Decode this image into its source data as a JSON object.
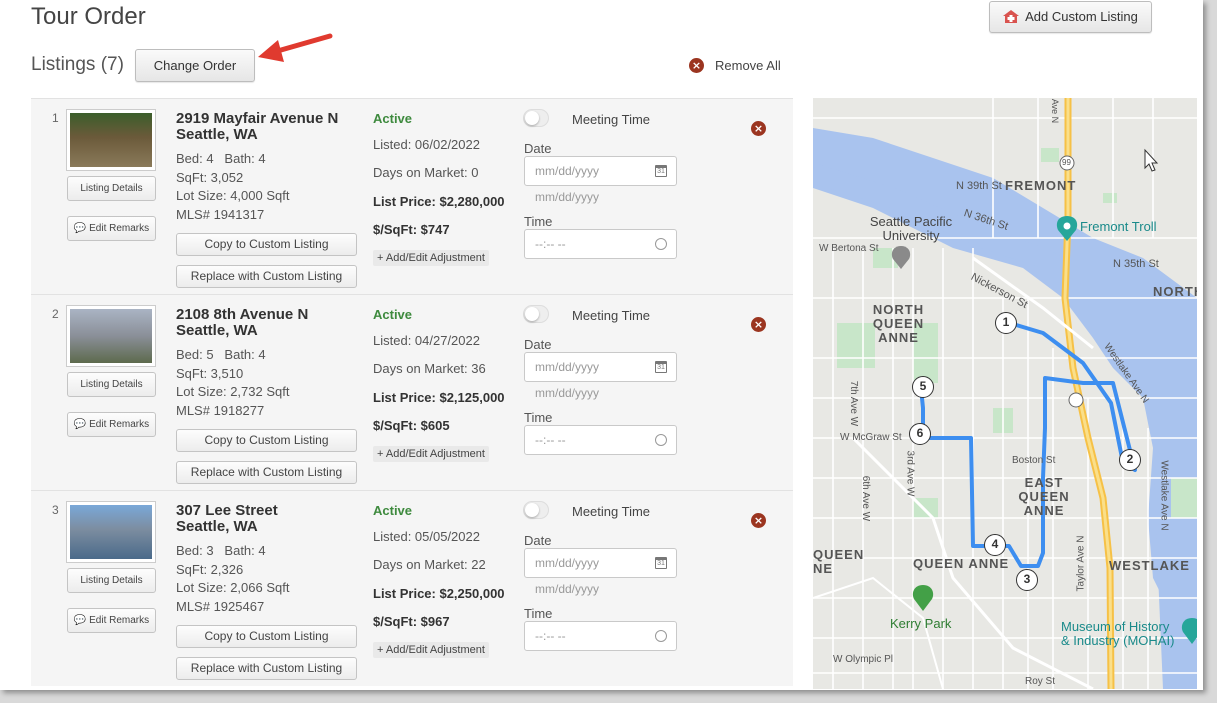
{
  "header": {
    "title": "Tour Order",
    "add_custom_listing": "Add Custom Listing",
    "listings_label": "Listings (7)",
    "change_order": "Change Order",
    "remove_all": "Remove All"
  },
  "listing_buttons": {
    "details": "Listing Details",
    "remarks": "Edit Remarks",
    "copy": "Copy to Custom Listing",
    "replace": "Replace with Custom Listing",
    "adjustment": "+ Add/Edit Adjustment",
    "meeting_time": "Meeting Time",
    "date_label": "Date",
    "time_label": "Time",
    "date_placeholder": "mm/dd/yyyy",
    "date_hint": "mm/dd/yyyy",
    "time_placeholder": "--:-- --"
  },
  "listings": [
    {
      "index": "1",
      "street": "2919 Mayfair Avenue N",
      "city": "Seattle, WA",
      "bed_bath": "Bed: 4   Bath: 4",
      "sqft": "SqFt: 3,052",
      "lot": "Lot Size: 4,000 Sqft",
      "mls": "MLS# 1941317",
      "status": "Active",
      "listed": "Listed: 06/02/2022",
      "dom": "Days on Market: 0",
      "price": "List Price: $2,280,000",
      "ppsf": "$/SqFt: $747"
    },
    {
      "index": "2",
      "street": "2108 8th Avenue N",
      "city": "Seattle, WA",
      "bed_bath": "Bed: 5   Bath: 4",
      "sqft": "SqFt: 3,510",
      "lot": "Lot Size: 2,732 Sqft",
      "mls": "MLS# 1918277",
      "status": "Active",
      "listed": "Listed: 04/27/2022",
      "dom": "Days on Market: 36",
      "price": "List Price: $2,125,000",
      "ppsf": "$/SqFt: $605"
    },
    {
      "index": "3",
      "street": "307 Lee Street",
      "city": "Seattle, WA",
      "bed_bath": "Bed: 3   Bath: 4",
      "sqft": "SqFt: 2,326",
      "lot": "Lot Size: 2,066 Sqft",
      "mls": "MLS# 1925467",
      "status": "Active",
      "listed": "Listed: 05/05/2022",
      "dom": "Days on Market: 22",
      "price": "List Price: $2,250,000",
      "ppsf": "$/SqFt: $967"
    }
  ],
  "map": {
    "labels": {
      "fremont": "FREMONT",
      "n39": "N 39th St",
      "n36": "N 36th St",
      "n35": "N 35th St",
      "fremont_troll": "Fremont Troll",
      "spu": "Seattle Pacific University",
      "bertona": "W Bertona St",
      "nickerson": "Nickerson St",
      "north_qa": "NORTH QUEEN ANNE",
      "north": "NORTH",
      "westlake_ave": "Westlake Ave N",
      "mcgraw": "W McGraw St",
      "boston": "Boston St",
      "east_qa": "EAST QUEEN ANNE",
      "queen_anne": "QUEEN ANNE",
      "queen_left": "QUEEN NE",
      "westlake": "WESTLAKE",
      "kerry": "Kerry Park",
      "mohai": "Museum of History & Industry (MOHAI)",
      "olympic": "W Olympic Pl",
      "roy": "Roy St",
      "ave7": "7th Ave W",
      "ave6": "6th Ave W",
      "ave3": "3rd Ave W",
      "taylor": "Taylor Ave N",
      "westlake_n": "Westlake Ave N",
      "route99": "99",
      "ave_n": "Ave N",
      "sidewalk_st": "rson St"
    },
    "stops": [
      "1",
      "2",
      "3",
      "4",
      "5",
      "6"
    ],
    "route_color": "#3d8ef0"
  },
  "colors": {
    "active": "#3e8a3e",
    "remove": "#9b3520",
    "arrow": "#e03a2f"
  }
}
